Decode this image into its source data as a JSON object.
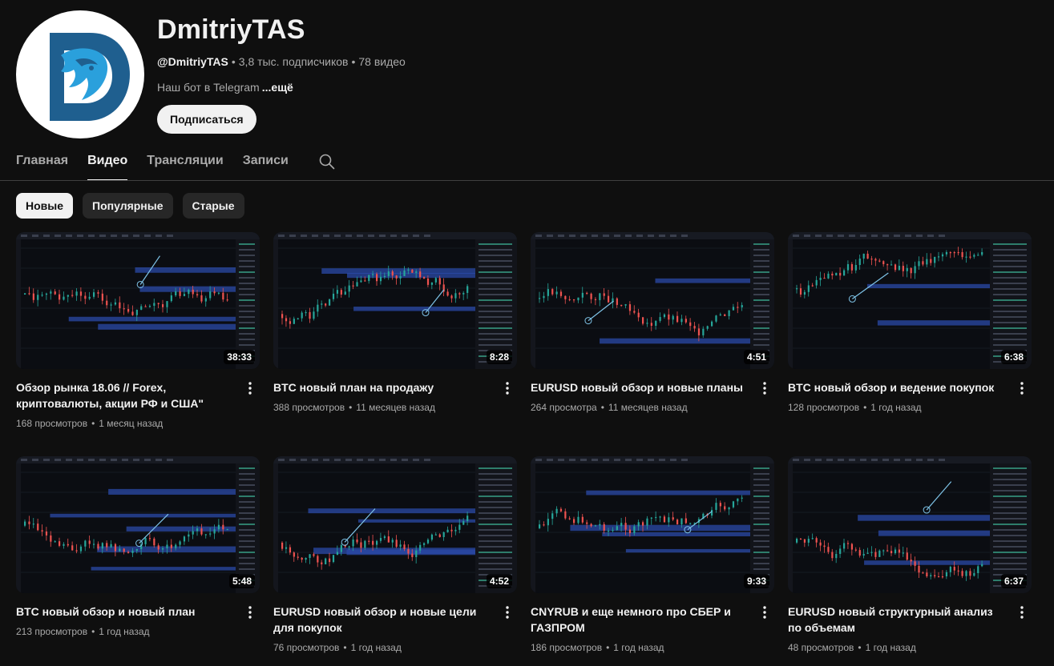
{
  "channel": {
    "name": "DmitriyTAS",
    "handle": "@DmitriyTAS",
    "subscribers": "3,8 тыс. подписчиков",
    "video_count": "78 видео",
    "meta_separator": "•",
    "description": "Наш бот в Telegram",
    "more_label": "...ещё",
    "subscribe_label": "Подписаться",
    "avatar_icon": "lion-d-logo-icon"
  },
  "tabs": [
    {
      "label": "Главная",
      "active": false
    },
    {
      "label": "Видео",
      "active": true
    },
    {
      "label": "Трансляции",
      "active": false
    },
    {
      "label": "Записи",
      "active": false
    }
  ],
  "filters": [
    {
      "label": "Новые",
      "active": true
    },
    {
      "label": "Популярные",
      "active": false
    },
    {
      "label": "Старые",
      "active": false
    }
  ],
  "videos": [
    {
      "title": "Обзор рынка 18.06 // Forex, криптовалюты, акции РФ и США\"",
      "views": "168 просмотров",
      "age": "1 месяц назад",
      "duration": "38:33"
    },
    {
      "title": "BTC новый план на продажу",
      "views": "388 просмотров",
      "age": "11 месяцев назад",
      "duration": "8:28"
    },
    {
      "title": "EURUSD новый обзор и новые планы",
      "views": "264 просмотра",
      "age": "11 месяцев назад",
      "duration": "4:51"
    },
    {
      "title": "BTC новый обзор и ведение покупок",
      "views": "128 просмотров",
      "age": "1 год назад",
      "duration": "6:38"
    },
    {
      "title": "BTC новый обзор и новый план",
      "views": "213 просмотров",
      "age": "1 год назад",
      "duration": "5:48"
    },
    {
      "title": "EURUSD новый обзор и новые цели для покупок",
      "views": "76 просмотров",
      "age": "1 год назад",
      "duration": "4:52"
    },
    {
      "title": "CNYRUB и еще немного про СБЕР и ГАЗПРОМ",
      "views": "186 просмотров",
      "age": "1 год назад",
      "duration": "9:33"
    },
    {
      "title": "EURUSD новый структурный анализ по объемам",
      "views": "48 просмотров",
      "age": "1 год назад",
      "duration": "6:37"
    }
  ],
  "colors": {
    "background": "#0f0f0f",
    "text_primary": "#f1f1f1",
    "text_secondary": "#aaaaaa",
    "chip_bg": "#272727",
    "logo_blue": "#1f5f8f",
    "candle_up": "#26a69a",
    "candle_down": "#ef5350",
    "zone_blue": "#2b4aa8"
  }
}
